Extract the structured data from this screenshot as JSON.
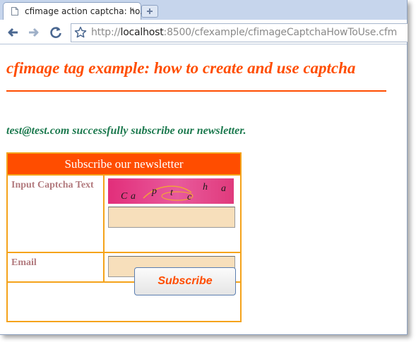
{
  "browser": {
    "tab_title": "cfimage action captcha: ho...",
    "tab_close": "×",
    "url_prefix": "http://",
    "url_host": "localhost",
    "url_rest": ":8500/cfexample/cfimageCaptchaHowToUse.cfm"
  },
  "page": {
    "title": "cfimage tag example: how to create and use captcha",
    "success_message": "test@test.com successfully subscribe our newsletter."
  },
  "form": {
    "header": "Subscribe our newsletter",
    "captcha_label": "Input Captcha Text",
    "captcha_text": "Captcha",
    "captcha_value": "",
    "email_label": "Email",
    "email_value": "",
    "submit_label": "Subscribe"
  },
  "colors": {
    "accent": "#ff4d00",
    "success": "#1d7a4f",
    "border": "#f5a31a",
    "field_bg": "#f7dfbb"
  }
}
